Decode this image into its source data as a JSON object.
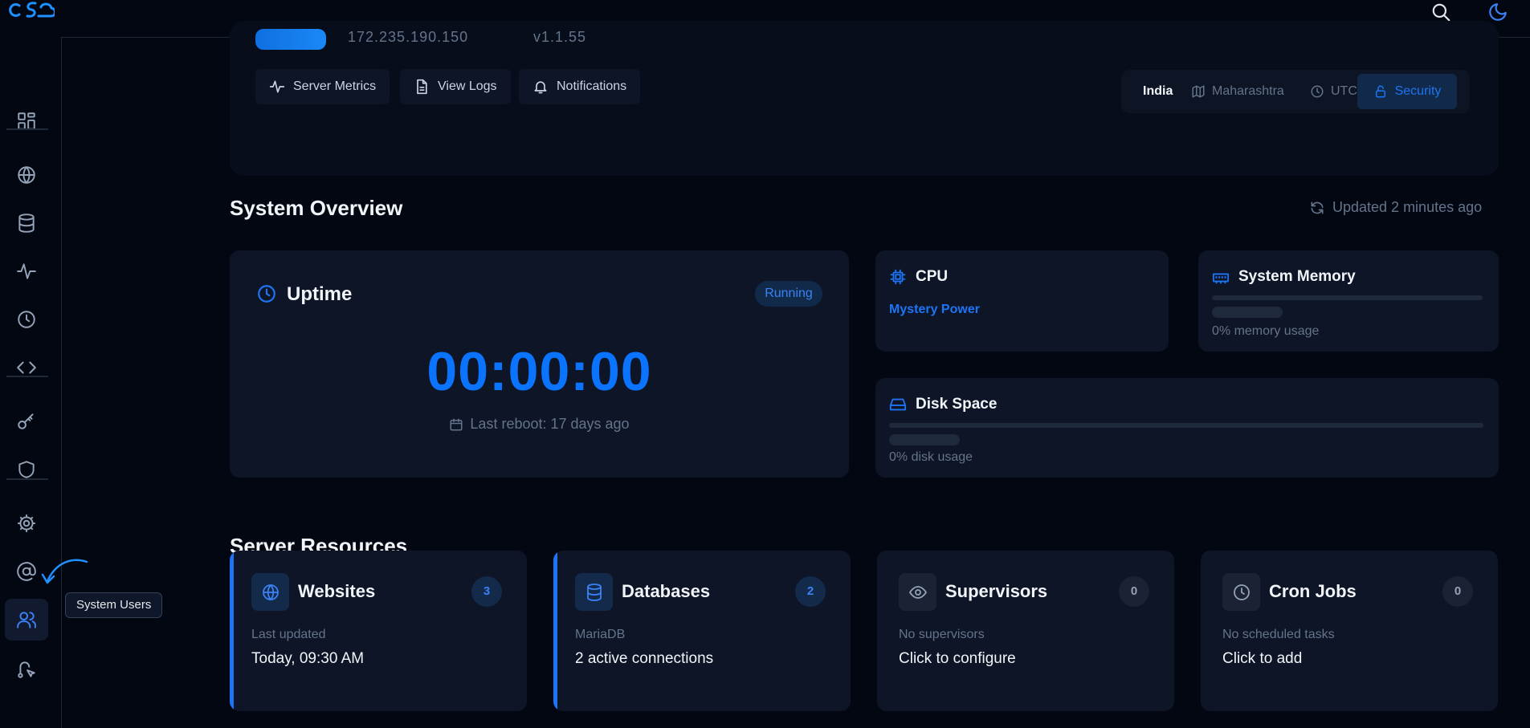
{
  "header": {
    "ip_fragment": "172.235.190.150",
    "version_fragment": "v1.1.55",
    "buttons": [
      "Server Metrics",
      "View Logs",
      "Notifications"
    ],
    "location": {
      "country": "India",
      "region": "Maharashtra",
      "timezone": "UTC",
      "security": "Security"
    }
  },
  "overview": {
    "title": "System Overview",
    "updated": "Updated 2 minutes ago",
    "uptime": {
      "title": "Uptime",
      "status": "Running",
      "time": "00:00:00",
      "reboot": "Last reboot: 17 days ago"
    },
    "cpu": {
      "title": "CPU",
      "model": "Mystery Power"
    },
    "memory": {
      "title": "System Memory",
      "usage": "0% memory usage",
      "percent": 0
    },
    "disk": {
      "title": "Disk Space",
      "usage": "0% disk usage",
      "percent": 0
    }
  },
  "resources": {
    "title": "Server Resources",
    "cards": [
      {
        "title": "Websites",
        "count": "3",
        "sub": "Last updated",
        "value": "Today, 09:30 AM"
      },
      {
        "title": "Databases",
        "count": "2",
        "sub": "MariaDB",
        "value": "2 active connections"
      },
      {
        "title": "Supervisors",
        "count": "0",
        "sub": "No supervisors",
        "value": "Click to configure"
      },
      {
        "title": "Cron Jobs",
        "count": "0",
        "sub": "No scheduled tasks",
        "value": "Click to add"
      }
    ]
  },
  "sidebar": {
    "tooltip": "System Users"
  },
  "colors": {
    "accent": "#1d74f5",
    "background": "#030712",
    "card": "#0e1526"
  }
}
